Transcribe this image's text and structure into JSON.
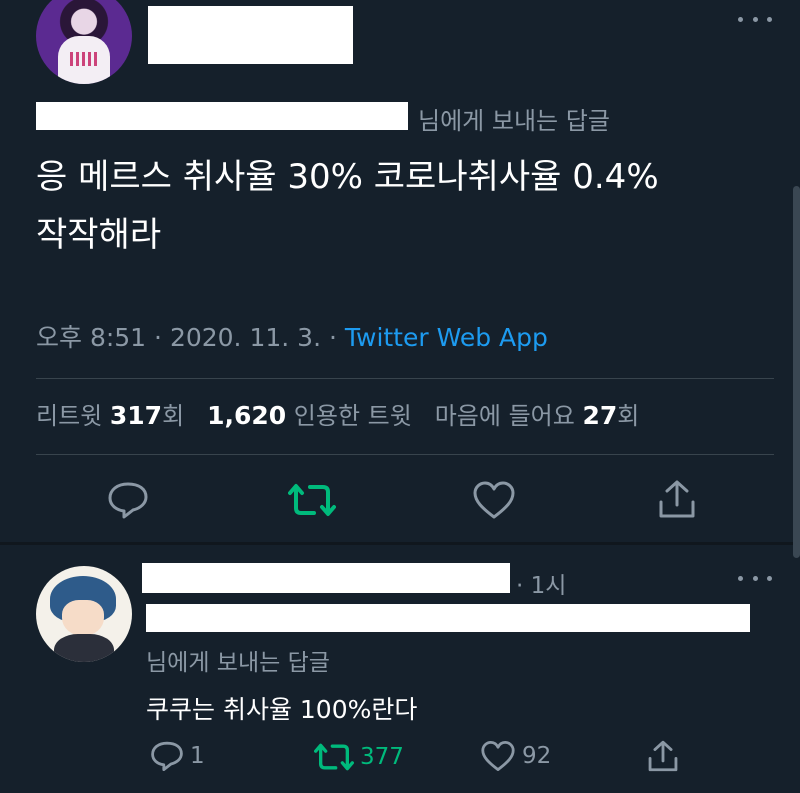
{
  "main_tweet": {
    "reply_to_suffix": "님에게 보내는 답글",
    "text": "응 메르스 취사율 30% 코로나취사율 0.4%\n작작해라",
    "time": "오후 8:51",
    "sep1": " · ",
    "date": "2020. 11. 3.",
    "sep2": " · ",
    "source": "Twitter Web App",
    "stats": {
      "retweets_label": "리트윗",
      "retweets_value": "317",
      "retweets_unit": "회",
      "quotes_value": "1,620",
      "quotes_label": "인용한 트윗",
      "likes_label": "마음에 들어요",
      "likes_value": "27",
      "likes_unit": "회"
    }
  },
  "reply_tweet": {
    "time": "· 1시",
    "reply_to_suffix": "님에게 보내는 답글",
    "text": "쿠쿠는 취사율 100%란다",
    "reply_count": "1",
    "retweet_count": "377",
    "like_count": "92"
  },
  "colors": {
    "background": "#15202b",
    "muted": "#8b98a5",
    "link": "#1d9bf0",
    "retweet": "#00ba7c",
    "divider": "#38444d"
  },
  "icons": [
    "more-icon",
    "reply-icon",
    "retweet-icon",
    "like-icon",
    "share-icon"
  ]
}
